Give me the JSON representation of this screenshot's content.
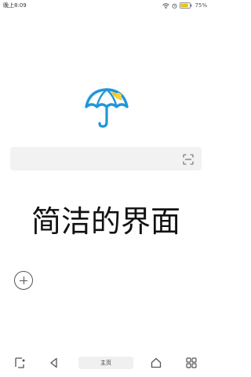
{
  "status_bar": {
    "time": "晚上8:09",
    "battery": "75%"
  },
  "logo": {
    "icon": "umbrella-icon",
    "colors": {
      "canopy": "#2196d9",
      "accent": "#f2c318"
    }
  },
  "search": {
    "placeholder": "",
    "scan_icon": "scan-icon"
  },
  "slogan": "简洁的界面",
  "add_button": {
    "icon": "plus-icon"
  },
  "bottom_nav": {
    "home_label": "主页",
    "icons": [
      "tabs-icon",
      "back-icon",
      "home-icon",
      "apps-grid-icon"
    ]
  }
}
